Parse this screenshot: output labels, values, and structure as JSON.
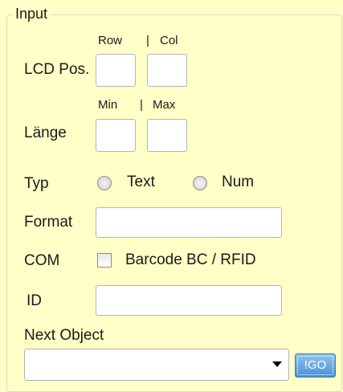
{
  "group": {
    "title": "Input"
  },
  "lcd_pos": {
    "label": "LCD Pos.",
    "row_header": "Row",
    "separator": "|",
    "col_header": "Col",
    "row_value": "",
    "col_value": ""
  },
  "laenge": {
    "label": "Länge",
    "min_header": "Min",
    "separator": "|",
    "max_header": "Max",
    "min_value": "",
    "max_value": ""
  },
  "typ": {
    "label": "Typ",
    "options": [
      "Text",
      "Num"
    ],
    "selected": null
  },
  "format": {
    "label": "Format",
    "value": ""
  },
  "com": {
    "label": "COM",
    "checkbox_label": "Barcode BC / RFID",
    "checked": false
  },
  "id": {
    "label": "ID",
    "value": ""
  },
  "next_object": {
    "label": "Next Object",
    "value": ""
  },
  "go_button": {
    "label": "!GO"
  },
  "colors": {
    "panel_bg": "#ffffc8",
    "go_button": "#4a8fd4"
  }
}
